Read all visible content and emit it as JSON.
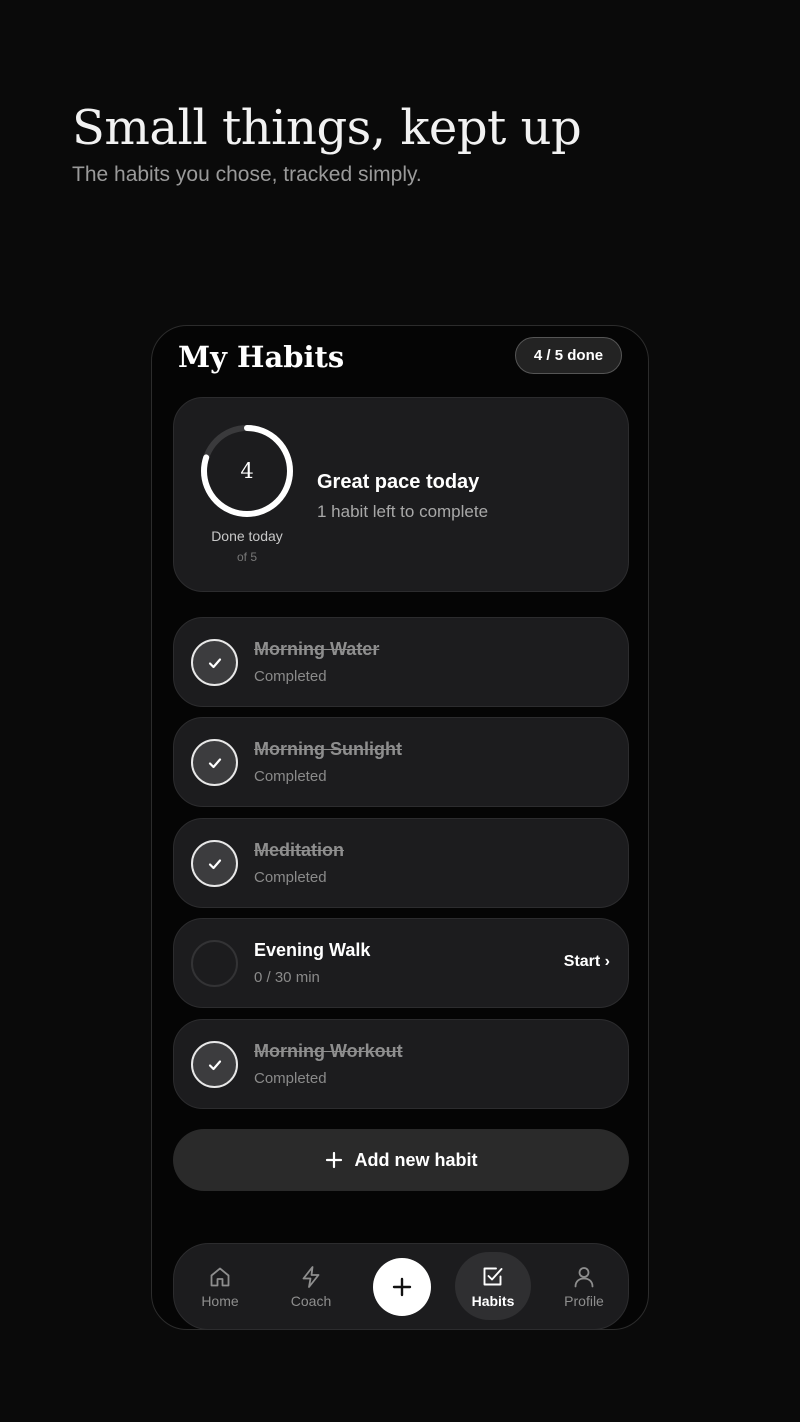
{
  "hero": {
    "title": "Small things, kept up",
    "subtitle": "The habits you chose, tracked simply."
  },
  "header": {
    "title": "My Habits",
    "done_badge": "4 / 5 done"
  },
  "summary": {
    "done_value": "4",
    "done_label": "Done today",
    "total_label": "of 5",
    "progress_fraction": 0.8,
    "title": "Great pace today",
    "subtitle": "1 habit left to complete"
  },
  "habits": [
    {
      "name": "Morning Water",
      "status": "Completed",
      "completed": true
    },
    {
      "name": "Morning Sunlight",
      "status": "Completed",
      "completed": true
    },
    {
      "name": "Meditation",
      "status": "Completed",
      "completed": true
    },
    {
      "name": "Evening Walk",
      "status": "0 / 30 min",
      "completed": false,
      "action": "Start ›"
    },
    {
      "name": "Morning Workout",
      "status": "Completed",
      "completed": true
    }
  ],
  "add_habit": {
    "label": "Add new habit",
    "icon": "plus-icon"
  },
  "tabbar": {
    "home": {
      "label": "Home",
      "icon": "home-icon"
    },
    "coach": {
      "label": "Coach",
      "icon": "lightning-icon"
    },
    "add": {
      "icon": "plus-icon"
    },
    "habits": {
      "label": "Habits",
      "icon": "checkbox-icon",
      "active": true
    },
    "profile": {
      "label": "Profile",
      "icon": "person-icon"
    }
  },
  "colors": {
    "background": "#0a0a0a",
    "card": "#1c1c1e",
    "accent": "#ffffff",
    "muted_text": "#8e8e8e"
  }
}
